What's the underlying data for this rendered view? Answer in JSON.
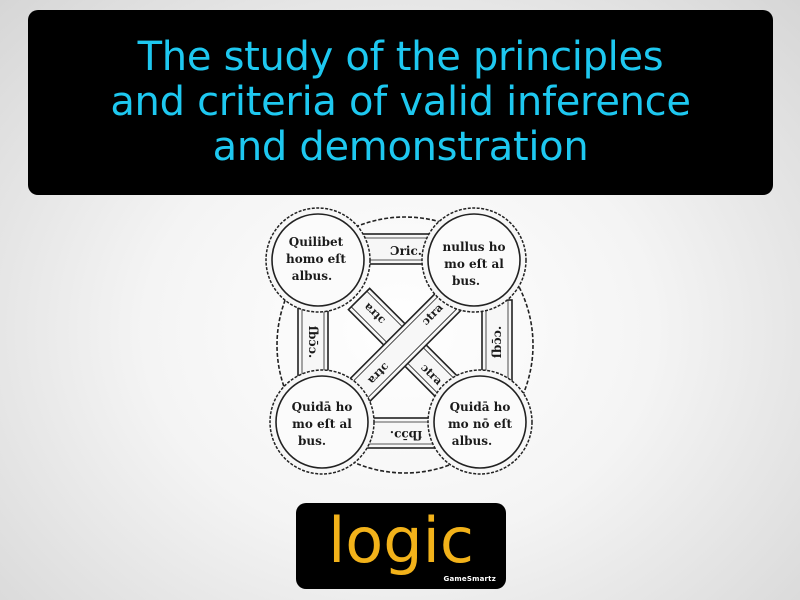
{
  "definition": {
    "lines": [
      "The study of the principles",
      "and criteria of valid inference",
      "and demonstration"
    ]
  },
  "diagram": {
    "corners": {
      "top_left": [
        "Quilibet",
        "homo eſt",
        "albus."
      ],
      "top_right": [
        "nullus ho",
        "mo eſt al",
        "bus."
      ],
      "bottom_left": [
        "Quidā ho",
        "mo eſt al",
        "bus."
      ],
      "bottom_right": [
        "Quidā ho",
        "mo nō eſt",
        "albus."
      ]
    },
    "relations": {
      "top": "Ɔric.",
      "bottom": "ſbɔ̄ɔ.",
      "left": "ſbɔ̄ɔ.",
      "right": "ſbɔ̄ɔ.",
      "diag_a1": "ɔtra",
      "diag_a2": "ɔtra",
      "diag_b1": "ɔtra",
      "diag_b2": "ɔtra"
    }
  },
  "term": {
    "word": "logic"
  },
  "brand": {
    "name": "GameSmartz"
  },
  "colors": {
    "definition_text": "#1ec8f0",
    "term_text": "#f2b21a",
    "panel_bg": "#000000"
  }
}
